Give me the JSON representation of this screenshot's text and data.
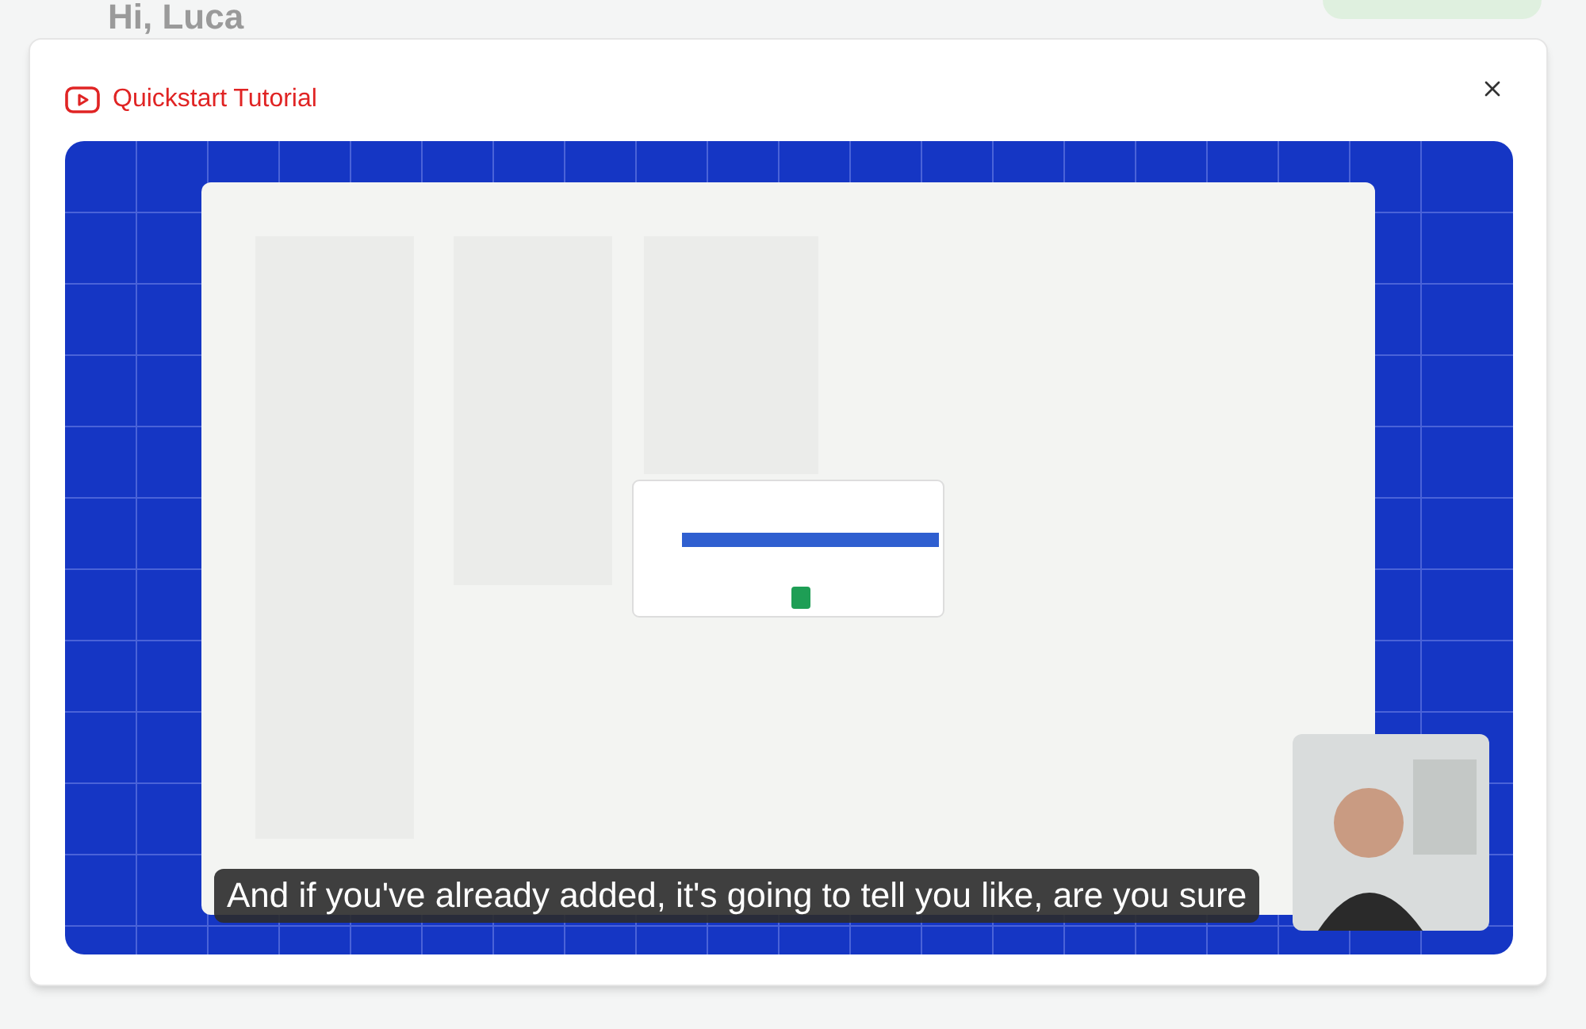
{
  "background": {
    "greeting": "Hi, Luca"
  },
  "dialog": {
    "title": "Quickstart Tutorial",
    "video": {
      "kind": "picture",
      "caption": "And if you've already added, it's going to tell you like, are you sure"
    }
  }
}
